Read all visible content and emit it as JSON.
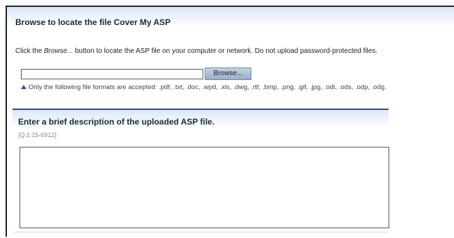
{
  "upload_section": {
    "title": "Browse to locate the file Cover My ASP",
    "instruction_prefix": "Click the ",
    "instruction_emphasis": "Browse...",
    "instruction_suffix": " button to locate the ASP file on your computer or network. Do not upload password-protected files.",
    "file_input_value": "",
    "browse_button_label": "Browse...",
    "formats_note": "Only the following file formats are accepted: .pdf, .txt, .doc, .wpd, .xls, .dwg, .rtf, .bmp, .png, .gif, .jpg, .odt, .ods, .odp, .odg.",
    "formats_icon": "triangle-up-icon"
  },
  "description_section": {
    "title": "Enter a brief description of the uploaded ASP file.",
    "question_code": "[Q:1:15-6912]",
    "textarea_value": ""
  },
  "colors": {
    "header_gradient_top": "#dce8f6",
    "section_rule": "#2e4e7e",
    "icon_blue": "#2a5a9c",
    "button_gradient_top": "#c3d2e2",
    "button_gradient_bottom": "#98aecb"
  }
}
